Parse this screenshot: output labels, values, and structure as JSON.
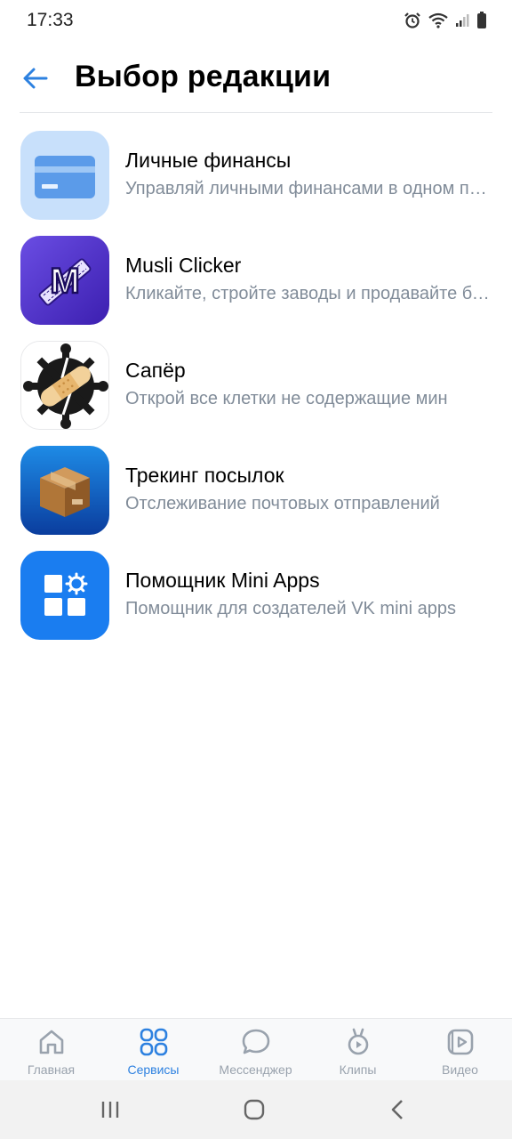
{
  "status_bar": {
    "time": "17:33",
    "icons": [
      "alarm-icon",
      "wifi-icon",
      "signal-icon",
      "battery-icon"
    ]
  },
  "header": {
    "title": "Выбор редакции",
    "back_icon": "back-arrow-icon"
  },
  "items": [
    {
      "title": "Личные финансы",
      "subtitle": "Управляй личными финансами в одном приложении",
      "icon": "credit-card-icon"
    },
    {
      "title": "Musli Clicker",
      "subtitle": "Кликайте, стройте заводы и продавайте батончики",
      "icon": "musli-clicker-icon"
    },
    {
      "title": "Сапёр",
      "subtitle": "Открой все клетки не содержащие мин",
      "icon": "mine-bandage-icon"
    },
    {
      "title": "Трекинг посылок",
      "subtitle": "Отслеживание почтовых отправлений",
      "icon": "parcel-box-icon"
    },
    {
      "title": "Помощник Mini Apps",
      "subtitle": "Помощник для создателей VK mini apps",
      "icon": "apps-gear-icon"
    }
  ],
  "tabbar": {
    "tabs": [
      {
        "label": "Главная",
        "icon": "home-icon",
        "active": false
      },
      {
        "label": "Сервисы",
        "icon": "services-grid-icon",
        "active": true
      },
      {
        "label": "Мессенджер",
        "icon": "message-bubble-icon",
        "active": false
      },
      {
        "label": "Клипы",
        "icon": "clips-icon",
        "active": false
      },
      {
        "label": "Видео",
        "icon": "video-icon",
        "active": false
      }
    ]
  },
  "colors": {
    "accent": "#2d81e0",
    "secondary_text": "#818c99",
    "inactive_tab": "#99a2ad"
  }
}
